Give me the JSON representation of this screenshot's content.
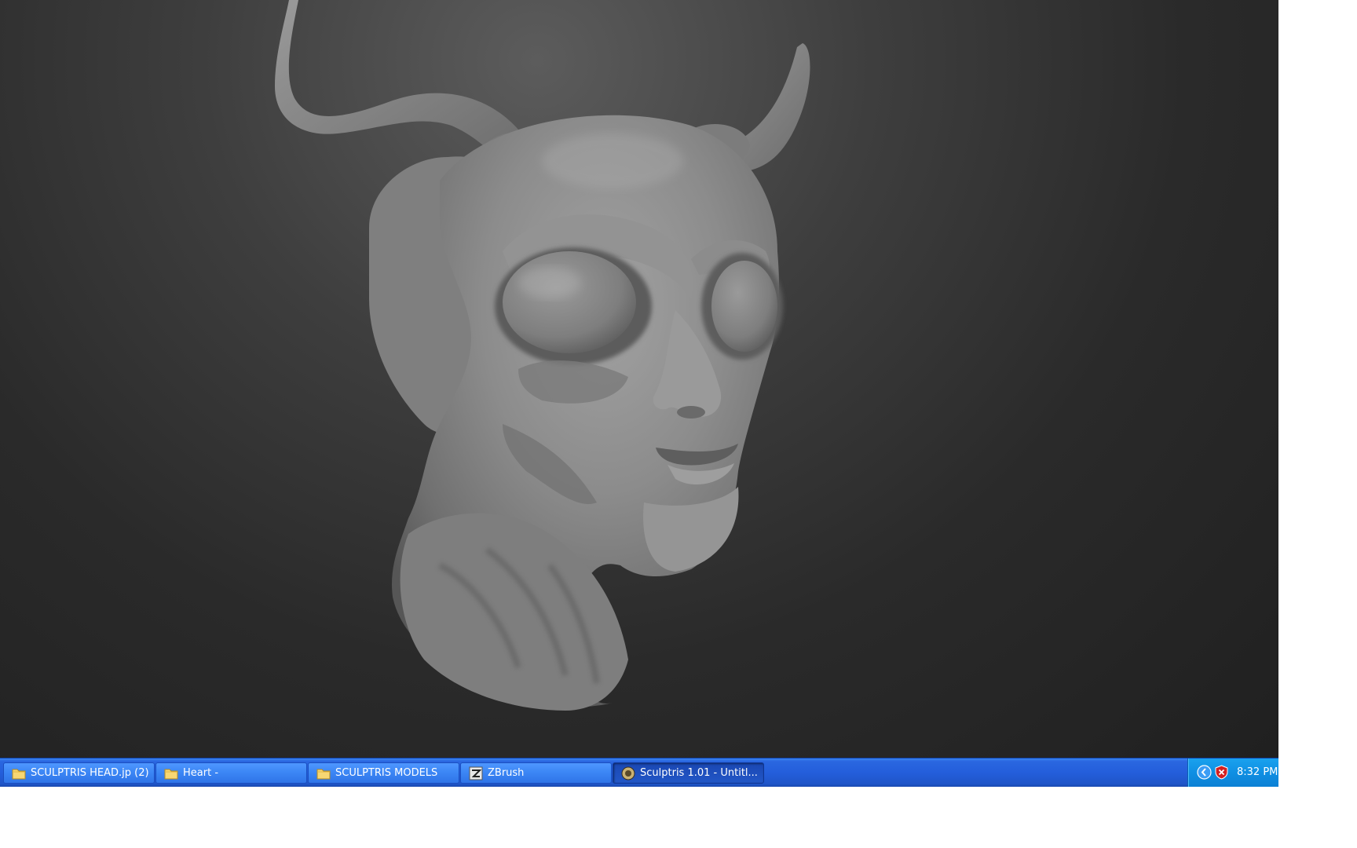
{
  "taskbar": {
    "buttons": [
      {
        "label": "SCULPTRIS HEAD.jp (2)",
        "icon": "folder-icon"
      },
      {
        "label": "Heart -",
        "icon": "folder-icon"
      },
      {
        "label": "SCULPTRIS MODELS",
        "icon": "folder-icon"
      },
      {
        "label": "ZBrush",
        "icon": "zbrush-icon"
      },
      {
        "label": "Sculptris 1.01 - Untitl...",
        "icon": "sculptris-icon",
        "active": true
      }
    ],
    "tray": {
      "icons": [
        "show-hidden-icons-arrow-icon",
        "security-shield-icon"
      ],
      "clock": "8:32 PM"
    }
  },
  "viewport": {
    "model": "horned-head-sculpt",
    "background_color": "#2a2a2a",
    "model_color": "#8a8a8a"
  },
  "colors": {
    "taskbar_blue": "#245edb",
    "tray_blue": "#0f8fe3",
    "active_button": "#1e4fbd"
  }
}
